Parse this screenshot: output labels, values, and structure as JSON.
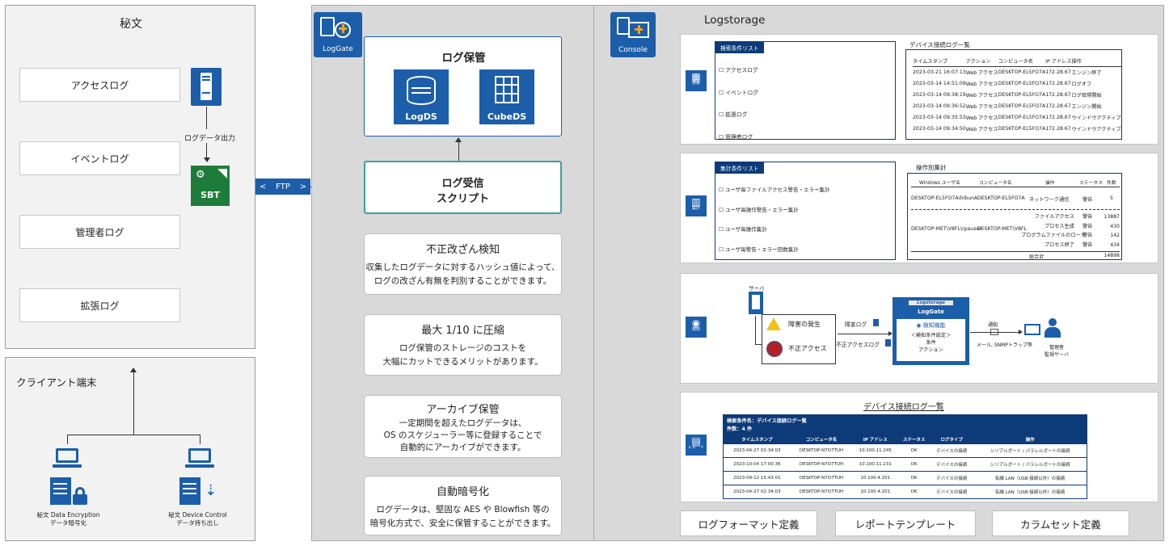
{
  "left": {
    "title": "秘文",
    "logs": [
      "アクセスログ",
      "イベントログ",
      "管理者ログ",
      "拡張ログ"
    ],
    "output_label": "ログデータ出力",
    "sbt_label": "SBT",
    "ftp_label": "FTP"
  },
  "client": {
    "title": "クライアント端末",
    "items": [
      {
        "line1": "秘文 Data Encryption",
        "line2": "データ暗号化"
      },
      {
        "line1": "秘文 Device Control",
        "line2": "データ持ち出し"
      }
    ]
  },
  "logagte": {
    "badge": "LogGate",
    "storage_title": "ログ保管",
    "logds": "LogDS",
    "cubeds": "CubeDS",
    "receive_line1": "ログ受信",
    "receive_line2": "スクリプト",
    "features": [
      {
        "title": "不正改ざん検知",
        "lines": [
          "収集したログデータに対するハッシュ値によって、",
          "ログの改ざん有無を判別することができます。"
        ]
      },
      {
        "title": "最大 1/10 に圧縮",
        "lines": [
          "ログ保管のストレージのコストを",
          "大幅にカットできるメリットがあります。"
        ]
      },
      {
        "title": "アーカイブ保管",
        "lines": [
          "一定期間を超えたログデータは、",
          "OS のスケジューラー等に登録することで",
          "自動的にアーカイブができます。"
        ]
      },
      {
        "title": "自動暗号化",
        "lines": [
          "ログデータは、堅固な AES や Blowfish 等の",
          "暗号化方式で、安全に保管することができます。"
        ]
      }
    ]
  },
  "logstorage": {
    "title": "Logstorage",
    "console_badge": "Console",
    "search": {
      "icon_label": "検索",
      "list_title": "検索条件リスト",
      "conditions": [
        "アクセスログ",
        "イベントログ",
        "拡張ログ",
        "管理者ログ"
      ],
      "table_title": "デバイス接続ログ一覧",
      "headers": [
        "タイムスタンプ",
        "アクション",
        "コンピュータ名",
        "IP アドレス",
        "操作"
      ],
      "rows": [
        [
          "2023-03-21 16:07:13",
          "Web アクセス",
          "DESKTOP-EL5FO7A",
          "172.28.67",
          "エンジン終了"
        ],
        [
          "2023-03-14 14:51:09",
          "Web アクセス",
          "DESKTOP-EL5FO7A",
          "172.28.67",
          "ログオフ"
        ],
        [
          "2023-03-14 09:38:19",
          "Web アクセス",
          "DESKTOP-EL5FO7A",
          "172.28.67",
          "ログ取得開始"
        ],
        [
          "2023-03-14 09:36:52",
          "Web アクセス",
          "DESKTOP-EL5FO7A",
          "172.28.67",
          "エンジン開始"
        ],
        [
          "2023-03-14 09:35:53",
          "Web アクセス",
          "DESKTOP-EL5FO7A",
          "172.28.67",
          "ウインドウアクティブ"
        ],
        [
          "2023-03-14 09:34:50",
          "Web アクセス",
          "DESKTOP-EL5FO7A",
          "172.28.67",
          "ウインドウアクティブ"
        ]
      ]
    },
    "aggregate": {
      "icon_label": "集計",
      "list_title": "集計条件リスト",
      "conditions": [
        "ユーザ毎ファイルアクセス警告・エラー集計",
        "ユーザ毎操作警告・エラー集計",
        "ユーザ毎操作集計",
        "ユーザ毎警告・エラー回数集計"
      ],
      "table_title": "操作別集計",
      "headers": [
        "Windows ユーザ名",
        "コンピュータ名",
        "操作",
        "ステータス",
        "件数"
      ],
      "row1": [
        "DESKTOP-EL5FO7A\\hibunA",
        "DESKTOP-EL5FO7A",
        "ネットワーク通信",
        "警告",
        "5"
      ],
      "row2_user": "DESKTOP-MET\\V8FL\\rpauser",
      "row2_pc": "DESKTOP-MET\\V8FL",
      "row2_items": [
        [
          "ファイルアクセス",
          "警告",
          "13887"
        ],
        [
          "プロセス生成",
          "警告",
          "430"
        ],
        [
          "プログラムファイルのロード",
          "警告",
          "142"
        ],
        [
          "プロセス終了",
          "警告",
          "434"
        ]
      ],
      "total_label": "総合計",
      "total_value": "14898"
    },
    "detect": {
      "icon_label": "検知",
      "server_label": "サーバ",
      "fault": "障害の発生",
      "unauthorized": "不正アクセス",
      "fault_log": "障害ログ",
      "access_log": "不正アクセスログ",
      "logo_top": "Logstorage",
      "logo_name": "LogGate",
      "func": "検知機能",
      "func_sub1": "＜検知条件設定＞",
      "func_sub2": "条件",
      "func_sub3": "アクション",
      "notify": "通知",
      "notify_sub": "メール, SNMPトラップ等",
      "admin1": "管理者",
      "admin2": "監視サーバ"
    },
    "report": {
      "icon_label": "レポート",
      "title": "デバイス接続ログ一覧",
      "cond1": "検索条件名：デバイス接続ログ一覧",
      "cond2": "件数：4 件",
      "headers": [
        "タイムスタンプ",
        "コンピュータ名",
        "IP アドレス",
        "ステータス",
        "ログタイプ",
        "操作"
      ],
      "rows": [
        [
          "2023-04-27 02:34:03",
          "DESKTOP-N7O7TUH",
          "10.100.11.245",
          "OK",
          "デバイスの接続",
          "シリアルポート / パラレルポートの接続"
        ],
        [
          "2023-10-04 17:00:36",
          "DESKTOP-N7O7TUH",
          "10.100.11.231",
          "OK",
          "デバイスの接続",
          "シリアルポート / パラレルポートの接続"
        ],
        [
          "2023-09-12 15:43:01",
          "DESKTOP-N7O7TUH",
          "10.100.4.201",
          "OK",
          "デバイスの接続",
          "有線 LAN（USB 接続以外）の接続"
        ],
        [
          "2023-04-27 02:34:03",
          "DESKTOP-N7O7TUH",
          "10.100.4.201",
          "OK",
          "デバイスの接続",
          "有線 LAN（USB 接続以外）の接続"
        ]
      ]
    },
    "buttons": [
      "ログフォーマット定義",
      "レポートテンプレート",
      "カラムセット定義"
    ]
  }
}
